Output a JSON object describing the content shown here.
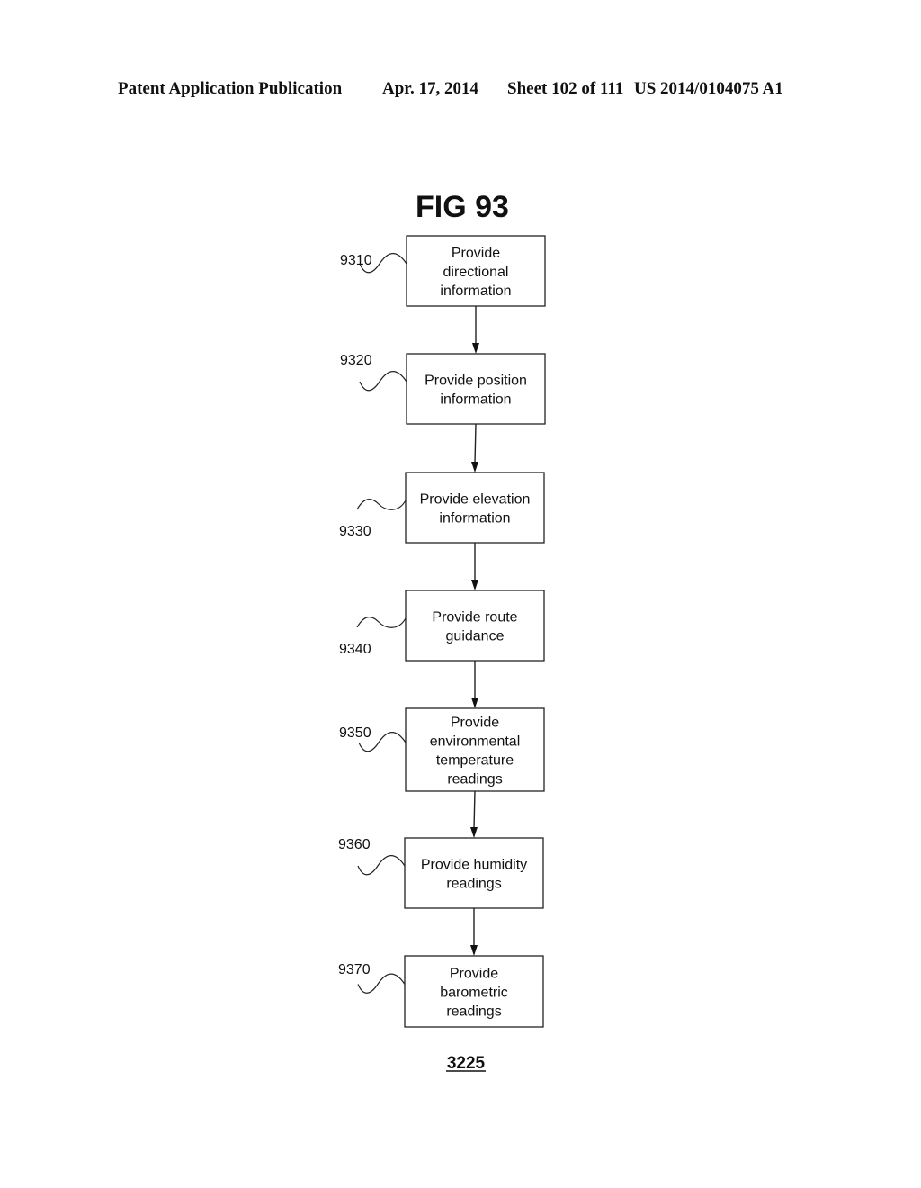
{
  "header": {
    "publication": "Patent Application Publication",
    "date": "Apr. 17, 2014",
    "sheet": "Sheet 102 of 111",
    "number": "US 2014/0104075 A1"
  },
  "figure": {
    "title": "FIG 93",
    "reference": "3225",
    "steps": [
      {
        "ref": "9310",
        "lines": [
          "Provide",
          "directional",
          "information"
        ],
        "label_side": "above"
      },
      {
        "ref": "9320",
        "lines": [
          "Provide position",
          "information"
        ],
        "label_side": "above"
      },
      {
        "ref": "9330",
        "lines": [
          "Provide elevation",
          "information"
        ],
        "label_side": "below"
      },
      {
        "ref": "9340",
        "lines": [
          "Provide route",
          "guidance"
        ],
        "label_side": "below"
      },
      {
        "ref": "9350",
        "lines": [
          "Provide",
          "environmental",
          "temperature",
          "readings"
        ],
        "label_side": "above"
      },
      {
        "ref": "9360",
        "lines": [
          "Provide humidity",
          "readings"
        ],
        "label_side": "above"
      },
      {
        "ref": "9370",
        "lines": [
          "Provide",
          "barometric",
          "readings"
        ],
        "label_side": "above"
      }
    ]
  }
}
